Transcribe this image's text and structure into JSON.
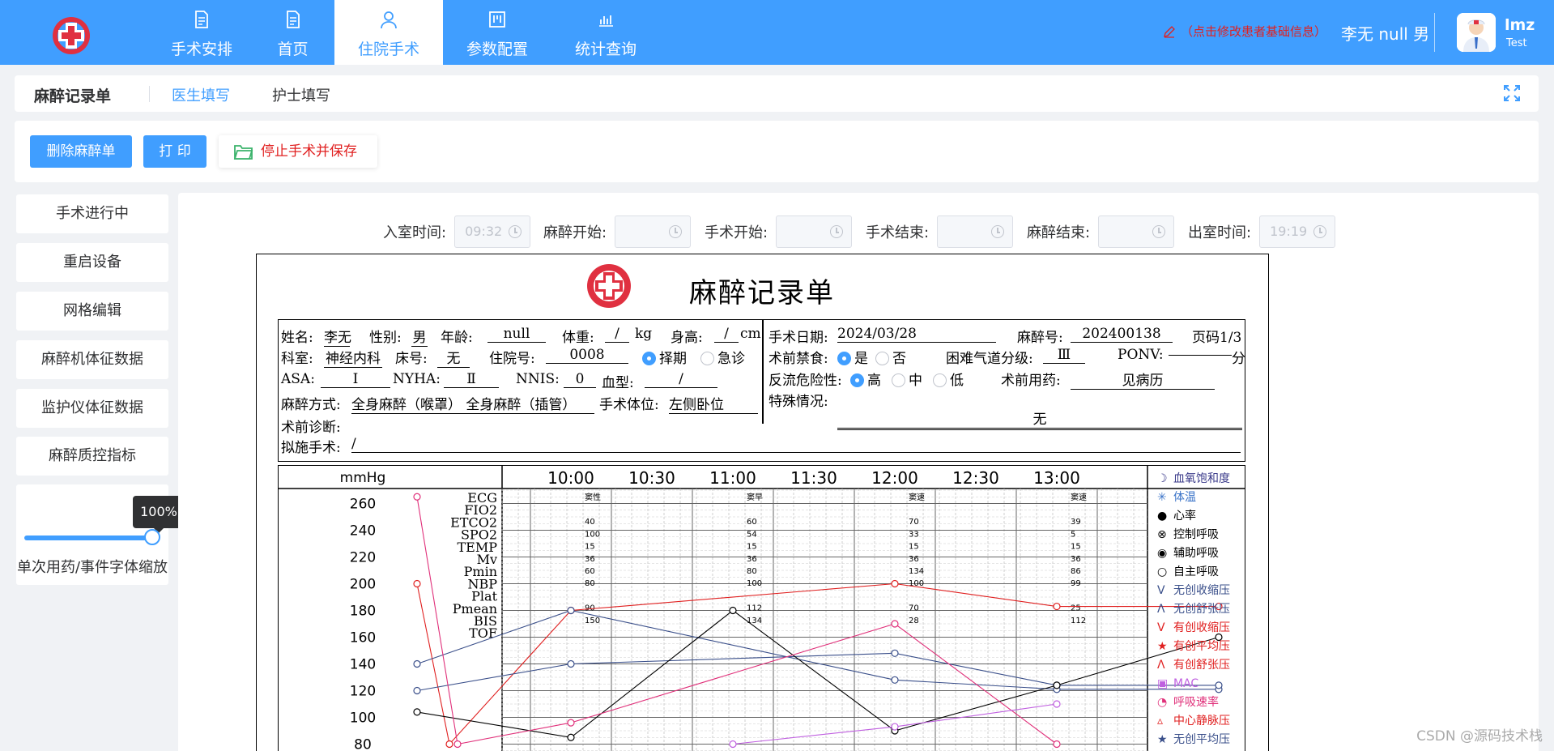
{
  "nav": {
    "items": [
      {
        "label": "手术安排",
        "icon": "document-icon"
      },
      {
        "label": "首页",
        "icon": "document-icon"
      },
      {
        "label": "住院手术",
        "icon": "user-icon"
      },
      {
        "label": "参数配置",
        "icon": "board-icon"
      },
      {
        "label": "统计查询",
        "icon": "bar-chart-icon"
      }
    ],
    "active_index": 2,
    "patient_edit_hint": "（点击修改患者基础信息）",
    "patient_summary": "李无 null 男",
    "user_name": "lmz",
    "user_role": "Test"
  },
  "tabs": {
    "title": "麻醉记录单",
    "items": [
      "医生填写",
      "护士填写"
    ],
    "active_index": 0
  },
  "toolbar": {
    "delete_label": "删除麻醉单",
    "print_label": "打 印",
    "stop_label": "停止手术并保存"
  },
  "sidebar": {
    "items": [
      "手术进行中",
      "重启设备",
      "网格编辑",
      "麻醉机体征数据",
      "监护仪体征数据",
      "麻醉质控指标"
    ],
    "zoom_value": "100%",
    "zoom_fraction": 1.0,
    "zoom_label": "单次用药/事件字体缩放"
  },
  "times": [
    {
      "label": "入室时间:",
      "value": "09:32"
    },
    {
      "label": "麻醉开始:",
      "value": ""
    },
    {
      "label": "手术开始:",
      "value": ""
    },
    {
      "label": "手术结束:",
      "value": ""
    },
    {
      "label": "麻醉结束:",
      "value": ""
    },
    {
      "label": "出室时间:",
      "value": "19:19"
    }
  ],
  "form": {
    "title": "麻醉记录单",
    "name_label": "姓名:",
    "name": "李无",
    "sex_label": "性别:",
    "sex": "男",
    "age_label": "年龄:",
    "age": "null",
    "weight_label": "体重:",
    "weight": "/",
    "weight_unit": "kg",
    "height_label": "身高:",
    "height": "/",
    "height_unit": "cm",
    "dept_label": "科室:",
    "dept": "神经内科",
    "bed_label": "床号:",
    "bed": "无",
    "admission_label": "住院号:",
    "admission": "0008",
    "elective": "择期",
    "emergency": "急诊",
    "asa_label": "ASA:",
    "asa": "Ⅰ",
    "nyha_label": "NYHA:",
    "nyha": "Ⅱ",
    "nnis_label": "NNIS:",
    "nnis": "0",
    "blood_label": "血型:",
    "blood": "/",
    "method_label": "麻醉方式:",
    "method": "全身麻醉（喉罩） 全身麻醉（插管）",
    "position_label": "手术体位:",
    "position": "左侧卧位",
    "diagnosis_label": "术前诊断:",
    "diagnosis": "",
    "planned_label": "拟施手术:",
    "planned": "/",
    "surgery_date_label": "手术日期:",
    "surgery_date": "2024/03/28",
    "anesthesia_no_label": "麻醉号:",
    "anesthesia_no": "202400138",
    "page_label": "页码1/3",
    "fasting_label": "术前禁食:",
    "fasting_yes": "是",
    "fasting_no": "否",
    "airway_label": "困难气道分级:",
    "airway": "Ⅲ",
    "ponv_label": "PONV:",
    "ponv_unit": "分",
    "reflux_label": "反流危险性:",
    "reflux_high": "高",
    "reflux_mid": "中",
    "reflux_low": "低",
    "premed_label": "术前用药:",
    "premed": "见病历",
    "special_label": "特殊情况:",
    "special": "无"
  },
  "chart_data": {
    "type": "line",
    "title": "",
    "ylabel": "mmHg",
    "x_ticks": [
      "10:00",
      "10:30",
      "11:00",
      "11:30",
      "12:00",
      "12:30",
      "13:00"
    ],
    "y_ticks": [
      260,
      240,
      220,
      200,
      180,
      160,
      140,
      120,
      100,
      80
    ],
    "row_labels": [
      "ECG",
      "FIO2",
      "ETCO2",
      "SPO2",
      "TEMP",
      "Mv",
      "Pmin",
      "NBP",
      "Plat",
      "Pmean",
      "BIS",
      "TOF"
    ],
    "columns": [
      {
        "header": "窦性",
        "values": [
          "",
          "40",
          "100",
          "15",
          "36",
          "60",
          "80",
          "",
          "90",
          "150"
        ]
      },
      {
        "header": "窦早",
        "values": [
          "",
          "60",
          "54",
          "15",
          "36",
          "80",
          "100",
          "",
          "112",
          "134"
        ]
      },
      {
        "header": "窦速",
        "values": [
          "",
          "70",
          "33",
          "15",
          "36",
          "134",
          "100",
          "",
          "70",
          "28"
        ]
      },
      {
        "header": "窦速",
        "values": [
          "",
          "39",
          "5",
          "15",
          "36",
          "86",
          "99",
          "",
          "25",
          "112"
        ]
      }
    ],
    "legend": [
      {
        "name": "血氧饱和度",
        "color": "#3a3a8a",
        "symbol": "☽"
      },
      {
        "name": "体温",
        "color": "#3a73c8",
        "symbol": "✳"
      },
      {
        "name": "心率",
        "color": "#000000",
        "symbol": "●"
      },
      {
        "name": "控制呼吸",
        "color": "#000000",
        "symbol": "⊗"
      },
      {
        "name": "辅助呼吸",
        "color": "#000000",
        "symbol": "◉"
      },
      {
        "name": "自主呼吸",
        "color": "#000000",
        "symbol": "○"
      },
      {
        "name": "无创收缩压",
        "color": "#3a4f8a",
        "symbol": "V"
      },
      {
        "name": "无创舒张压",
        "color": "#3a4f8a",
        "symbol": "Λ"
      },
      {
        "name": "有创收缩压",
        "color": "#e02020",
        "symbol": "V"
      },
      {
        "name": "有创平均压",
        "color": "#e02020",
        "symbol": "★"
      },
      {
        "name": "有创舒张压",
        "color": "#e02020",
        "symbol": "Λ"
      },
      {
        "name": "MAC",
        "color": "#c060e0",
        "symbol": "▣"
      },
      {
        "name": "呼吸速率",
        "color": "#e0307a",
        "symbol": "◔"
      },
      {
        "name": "中心静脉压",
        "color": "#e02020",
        "symbol": "▵"
      },
      {
        "name": "无创平均压",
        "color": "#3a4f8a",
        "symbol": "★"
      }
    ],
    "series": [
      {
        "color": "#e02020",
        "points": [
          [
            0.05,
            200
          ],
          [
            0.25,
            80
          ],
          [
            1.0,
            180
          ],
          [
            3.0,
            200
          ],
          [
            4.0,
            183
          ],
          [
            5.0,
            183
          ]
        ]
      },
      {
        "color": "#3a4f8a",
        "points": [
          [
            0.05,
            140
          ],
          [
            1.0,
            180
          ],
          [
            3.0,
            128
          ],
          [
            4.0,
            121
          ],
          [
            5.0,
            121
          ]
        ]
      },
      {
        "color": "#3a4f8a",
        "points": [
          [
            0.05,
            120
          ],
          [
            1.0,
            140
          ],
          [
            3.0,
            148
          ],
          [
            4.0,
            124
          ],
          [
            5.0,
            124
          ]
        ]
      },
      {
        "color": "#000000",
        "points": [
          [
            0.05,
            104
          ],
          [
            1.0,
            85
          ],
          [
            2.0,
            180
          ],
          [
            3.0,
            90
          ],
          [
            4.0,
            124
          ],
          [
            5.0,
            160
          ]
        ]
      },
      {
        "color": "#e0307a",
        "points": [
          [
            0.05,
            265
          ],
          [
            0.3,
            80
          ],
          [
            1.0,
            96
          ],
          [
            3.0,
            170
          ],
          [
            4.0,
            80
          ]
        ]
      },
      {
        "color": "#c060e0",
        "points": [
          [
            2.0,
            80
          ],
          [
            3.0,
            93
          ],
          [
            4.0,
            110
          ]
        ]
      }
    ],
    "ylim": [
      70,
      270
    ],
    "grid": true,
    "legend_position": "right"
  },
  "watermark": "CSDN @源码技术栈"
}
